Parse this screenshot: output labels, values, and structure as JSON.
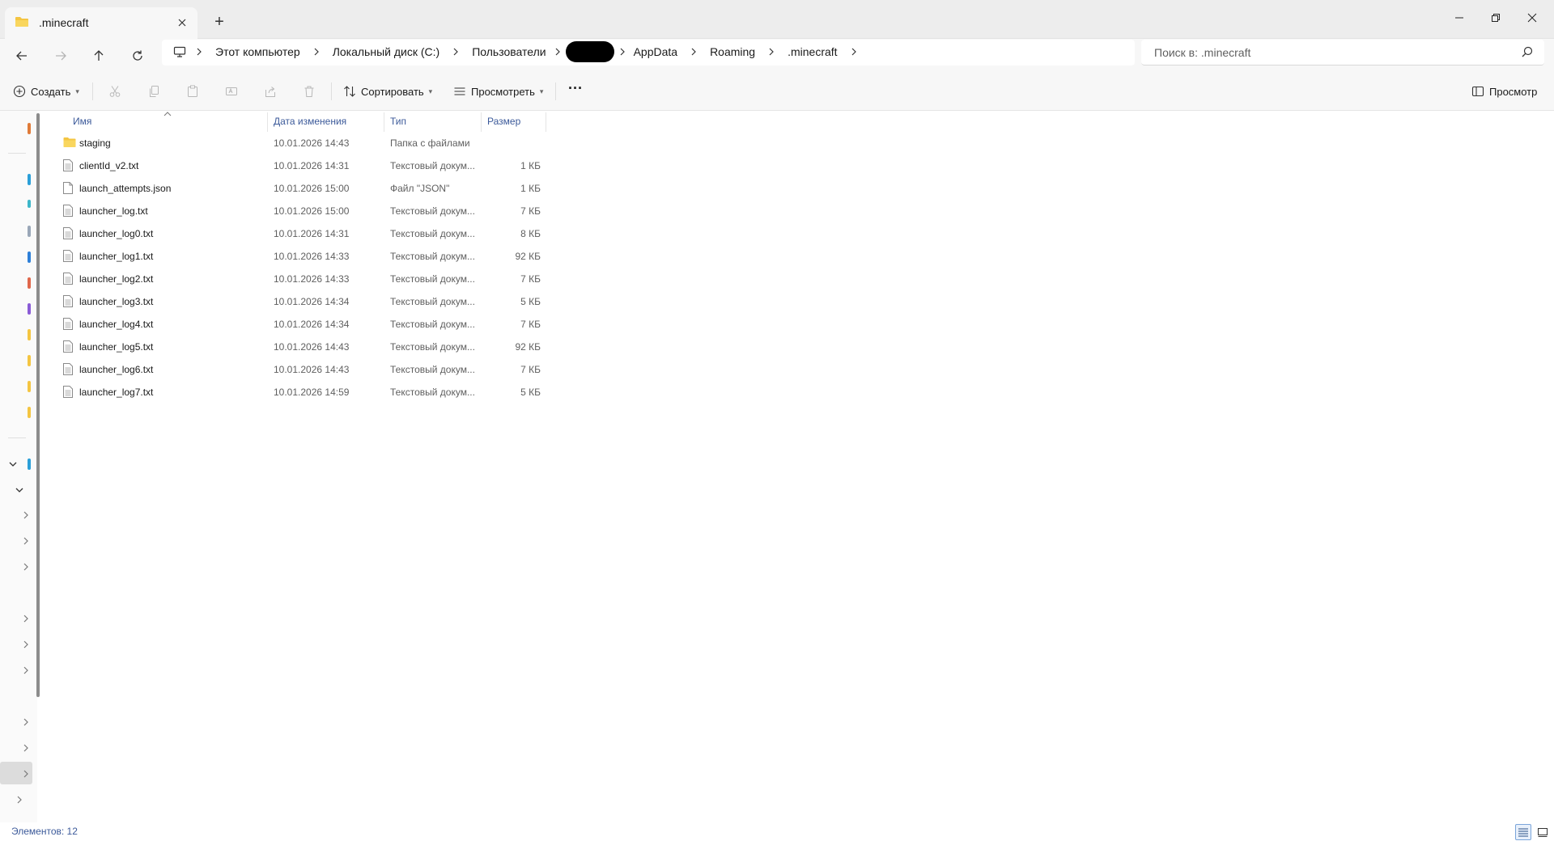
{
  "window": {
    "tab_title": ".minecraft",
    "new_tab_label": "+"
  },
  "breadcrumbs": [
    "Этот компьютер",
    "Локальный диск (C:)",
    "Пользователи",
    "AppData",
    "Roaming",
    ".minecraft"
  ],
  "search": {
    "placeholder": "Поиск в: .minecraft"
  },
  "toolbar": {
    "create_label": "Создать",
    "sort_label": "Сортировать",
    "view_label": "Просмотреть",
    "more_label": "···",
    "preview_label": "Просмотр"
  },
  "columns": {
    "name": "Имя",
    "date": "Дата изменения",
    "type": "Тип",
    "size": "Размер"
  },
  "files": [
    {
      "name": "staging",
      "date": "10.01.2026 14:43",
      "type": "Папка с файлами",
      "size": "",
      "kind": "folder"
    },
    {
      "name": "clientId_v2.txt",
      "date": "10.01.2026 14:31",
      "type": "Текстовый докум...",
      "size": "1 КБ",
      "kind": "text"
    },
    {
      "name": "launch_attempts.json",
      "date": "10.01.2026 15:00",
      "type": "Файл \"JSON\"",
      "size": "1 КБ",
      "kind": "blank"
    },
    {
      "name": "launcher_log.txt",
      "date": "10.01.2026 15:00",
      "type": "Текстовый докум...",
      "size": "7 КБ",
      "kind": "text"
    },
    {
      "name": "launcher_log0.txt",
      "date": "10.01.2026 14:31",
      "type": "Текстовый докум...",
      "size": "8 КБ",
      "kind": "text"
    },
    {
      "name": "launcher_log1.txt",
      "date": "10.01.2026 14:33",
      "type": "Текстовый докум...",
      "size": "92 КБ",
      "kind": "text"
    },
    {
      "name": "launcher_log2.txt",
      "date": "10.01.2026 14:33",
      "type": "Текстовый докум...",
      "size": "7 КБ",
      "kind": "text"
    },
    {
      "name": "launcher_log3.txt",
      "date": "10.01.2026 14:34",
      "type": "Текстовый докум...",
      "size": "5 КБ",
      "kind": "text"
    },
    {
      "name": "launcher_log4.txt",
      "date": "10.01.2026 14:34",
      "type": "Текстовый докум...",
      "size": "7 КБ",
      "kind": "text"
    },
    {
      "name": "launcher_log5.txt",
      "date": "10.01.2026 14:43",
      "type": "Текстовый докум...",
      "size": "92 КБ",
      "kind": "text"
    },
    {
      "name": "launcher_log6.txt",
      "date": "10.01.2026 14:43",
      "type": "Текстовый докум...",
      "size": "7 КБ",
      "kind": "text"
    },
    {
      "name": "launcher_log7.txt",
      "date": "10.01.2026 14:59",
      "type": "Текстовый докум...",
      "size": "5 КБ",
      "kind": "text"
    }
  ],
  "status": {
    "item_count": "Элементов: 12"
  },
  "colors": {
    "accent": "#3c5a9a",
    "folder": "#f4c542",
    "selection": "#7aa5da"
  }
}
